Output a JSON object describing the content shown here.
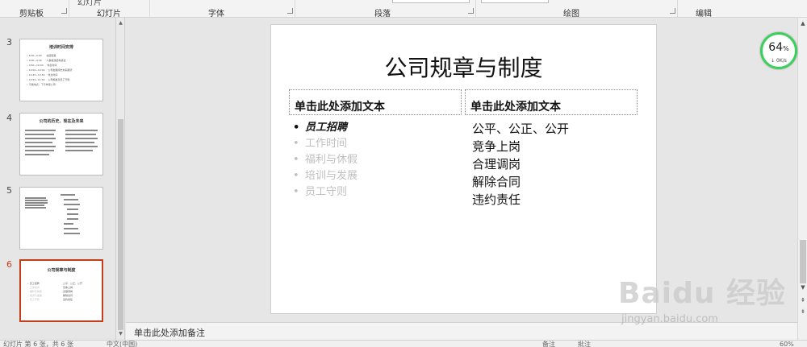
{
  "ribbon": {
    "groups": [
      "剪贴板",
      "幻灯片",
      "字体",
      "段落",
      "绘图",
      "编辑"
    ],
    "top_fragment": "幻灯片"
  },
  "thumbnails": [
    {
      "num": "3",
      "title": "培训时间安排",
      "lines": [
        "• 8:30~9:00      总结思路",
        "• 9:00~9:40      人事组建结构讲述",
        "• 9:50~10:00     休息时间",
        "• 10:00~10:40    公司发展简史未来展望",
        "• 10:40~10:50    休息时间",
        "• 10:50~11:50    公司规章及员工守则",
        "• 午餐地点：下午参观公司"
      ]
    },
    {
      "num": "4",
      "title": "公司的历史、现在及未来",
      "lines": []
    },
    {
      "num": "5",
      "title": "",
      "lines": []
    },
    {
      "num": "6",
      "title": "公司规章与制度",
      "lines": [
        "• 员工招聘",
        "• 工作时间",
        "• 福利与休假",
        "• 培训与发展",
        "• 员工守则"
      ],
      "right_lines": [
        "公平、公正、公开",
        "竞争上岗",
        "合理调岗",
        "解除合同",
        "违约责任"
      ]
    }
  ],
  "slide": {
    "title": "公司规章与制度",
    "left_placeholder": "单击此处添加文本",
    "right_placeholder": "单击此处添加文本",
    "left_items": [
      "员工招聘",
      "工作时间",
      "福利与休假",
      "培训与发展",
      "员工守则"
    ],
    "right_items": [
      "公平、公正、公开",
      "竞争上岗",
      "合理调岗",
      "解除合同",
      "违约责任"
    ]
  },
  "notes_placeholder": "单击此处添加备注",
  "gauge": {
    "percent": "64",
    "percent_sign": "%",
    "speed": "0K/s"
  },
  "watermark": {
    "brand": "Baidu 经验",
    "url": "jingyan.baidu.com"
  },
  "status_bar": {
    "left": "幻灯片 第 6 张，共 6 张",
    "lang": "中文(中国)",
    "notes_btn": "备注",
    "comments_btn": "批注",
    "zoom": "60%"
  },
  "colors": {
    "accent": "#c43e1c",
    "gauge": "#3ccf5c"
  }
}
